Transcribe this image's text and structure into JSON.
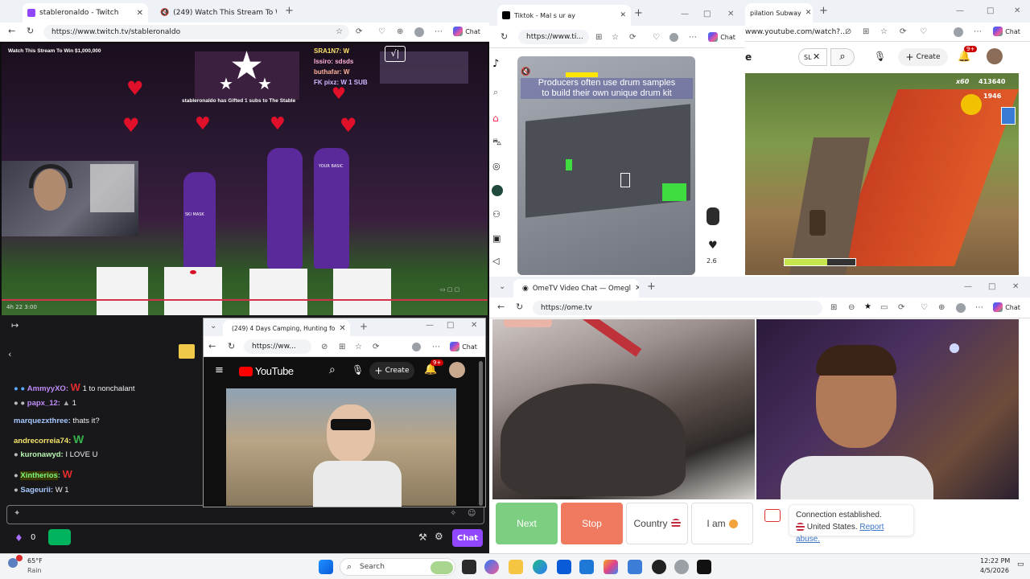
{
  "twitch_window": {
    "tabs": [
      {
        "label": "stableronaldo - Twitch"
      },
      {
        "label": "(249) Watch This Stream To W"
      }
    ],
    "url": "https://www.twitch.tv/stableronaldo",
    "chat_button": "Chat",
    "stream_title": "Watch This Stream To Win $1,000,000",
    "overlay_lines": [
      "SRA1N7: W",
      "Issiro: sdsds",
      "buthafar: W",
      "FK pixz: W 1 SUB"
    ],
    "gift_text": "stableronaldo has Gifted 1 subs to The Stable",
    "tshirt_texts": [
      "SKI MASK",
      "YOUR BASIC"
    ],
    "timestamp": "4h 22 3:00"
  },
  "twitch_chat": {
    "messages": [
      {
        "user": "AmmyyXO",
        "text": "1 to nonchalant",
        "color": "#c08cf8"
      },
      {
        "user": "papx_12",
        "text": "1",
        "color": "#c08cf8"
      },
      {
        "user": "marquezxthree",
        "text": "thats it?",
        "color": "#a6c8ff"
      },
      {
        "user": "andrecorreia74",
        "text": "",
        "color": "#f5e66b"
      },
      {
        "user": "kuronawyd",
        "text": "I LOVE U",
        "color": "#b7f4b1"
      },
      {
        "user": "Xintherios",
        "text": "",
        "color": "#7cf77c"
      },
      {
        "user": "Sageurii",
        "text": "W 1",
        "color": "#a6c8ff"
      }
    ],
    "points": "0",
    "chat_button": "Chat"
  },
  "tiktok_window": {
    "tab_label": "Tiktok - Mal s ur ay",
    "url": "https://www.ti...",
    "chat_button": "Chat",
    "caption_line1": "Producers often use drum samples",
    "caption_line2": "to build their own unique drum kit",
    "rating": "2.6"
  },
  "youtube_big_window": {
    "tab_label": "pilation Subway",
    "url": "www.youtube.com/watch?...",
    "chat_button": "Chat",
    "search_text": "SL",
    "create_label": "Create",
    "notif_count": "9+",
    "game_score": "413640",
    "game_multiplier": "x60",
    "game_coins": "1946"
  },
  "youtube_small_window": {
    "tab_label": "(249) 4 Days Camping, Hunting fo",
    "url": "https://ww...",
    "chat_button": "Chat",
    "logo_text": "YouTube",
    "create_label": "Create",
    "notif_count": "9+"
  },
  "ometv_window": {
    "tab_label": "OmeTV Video Chat — Omegl",
    "url": "https://ome.tv",
    "chat_button": "Chat",
    "buttons": {
      "next": "Next",
      "stop": "Stop",
      "country": "Country",
      "iam": "I am"
    },
    "status_line1": "Connection established.",
    "status_line2": "United States.",
    "report_link": "Report abuse."
  },
  "taskbar": {
    "weather_temp": "65°F",
    "weather_desc": "Rain",
    "search_placeholder": "Search",
    "time": "12:22 PM",
    "date": "4/5/2026"
  }
}
